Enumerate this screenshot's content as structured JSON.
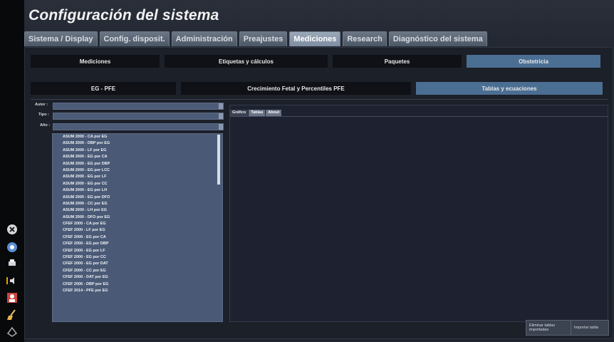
{
  "window": {
    "title": "Configuración del sistema"
  },
  "main_tabs": [
    {
      "label": "Sistema / Display",
      "active": false
    },
    {
      "label": "Config. disposit.",
      "active": false
    },
    {
      "label": "Administración",
      "active": false
    },
    {
      "label": "Preajustes",
      "active": false
    },
    {
      "label": "Mediciones",
      "active": true
    },
    {
      "label": "Research",
      "active": false
    },
    {
      "label": "Diagnóstico del sistema",
      "active": false
    }
  ],
  "sub_tabs": [
    {
      "label": "Mediciones",
      "active": false
    },
    {
      "label": "Etiquetas y cálculos",
      "active": false
    },
    {
      "label": "Paquetes",
      "active": false
    },
    {
      "label": "Obstetricia",
      "active": true
    }
  ],
  "obstetric_tabs": [
    {
      "label": "EG - PFE",
      "active": false
    },
    {
      "label": "Crecimiento Fetal y Percentiles PFE",
      "active": false
    },
    {
      "label": "Tablas y ecuaciones",
      "active": true
    }
  ],
  "filters": {
    "author_label": "Autor :",
    "type_label": "Tipo :",
    "year_label": "Año :",
    "author_value": "",
    "type_value": "",
    "year_value": ""
  },
  "table_list": [
    "ASUM 2000 - CA por EG",
    "ASUM 2000 - DBP por EG",
    "ASUM 2000 - LF por EG",
    "ASUM 2000 - EG por CA",
    "ASUM 2000 - EG por DBP",
    "ASUM 2000 - EG por LCC",
    "ASUM 2000 - EG por LF",
    "ASUM 2000 - EG por CC",
    "ASUM 2000 - EG por LH",
    "ASUM 2000 - EG por DFO",
    "ASUM 2000 - CC por EG",
    "ASUM 2000 - LH por EG",
    "ASUM 2000 - DFO por EG",
    "CFEF 2000 - CA por EG",
    "CFEF 2000 - LF por EG",
    "CFEF 2000 - EG por CA",
    "CFEF 2000 - EG por DBP",
    "CFEF 2000 - EG por LF",
    "CFEF 2000 - EG por CC",
    "CFEF 2000 - EG por DAT",
    "CFEF 2000 - CC por EG",
    "CFEF 2000 - DAT por EG",
    "CFEF 2006 - DBP por EG",
    "CFEF 2014 - PFE por EG"
  ],
  "view_tabs": [
    {
      "label": "Gráfico",
      "active": true
    },
    {
      "label": "Tablas",
      "active": false
    },
    {
      "label": "About",
      "active": false
    }
  ],
  "buttons": {
    "delete_imported": "Eliminar tablas importadas",
    "import_table": "Importar tabla"
  },
  "colors": {
    "active_subtab": "#4b6e93",
    "list_background": "#4a5a76"
  }
}
